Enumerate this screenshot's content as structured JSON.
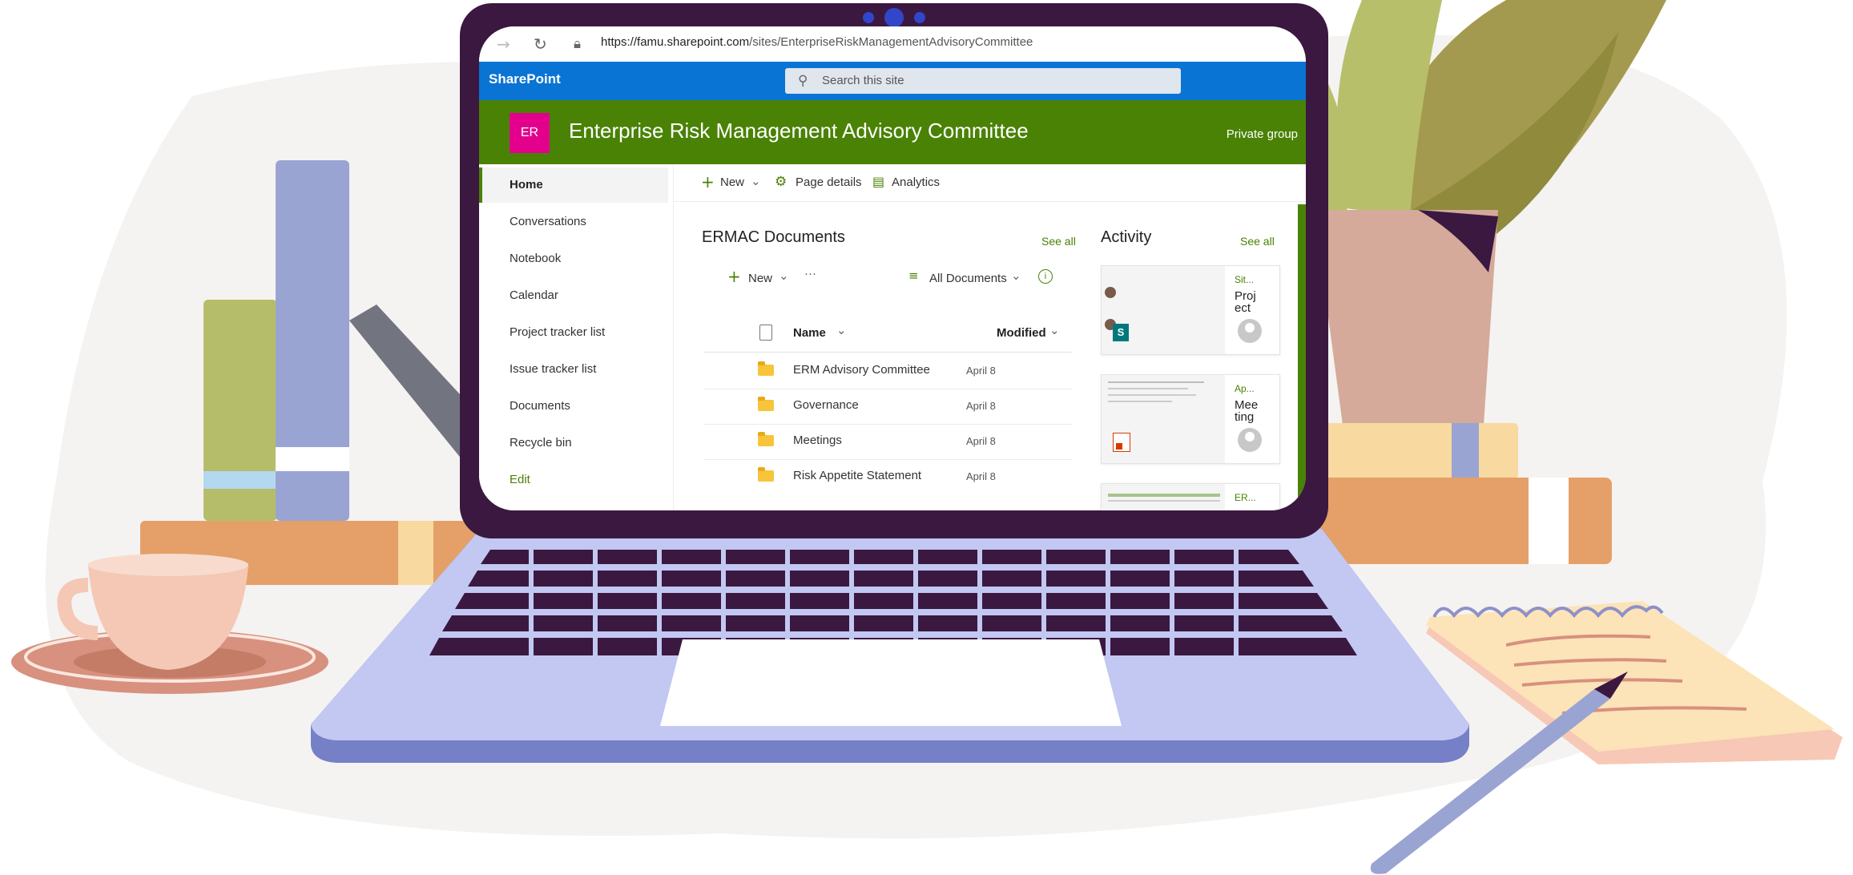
{
  "browser": {
    "url_host": "https://famu.sharepoint.com",
    "url_path": "/sites/EnterpriseRiskManagementAdvisoryCommittee"
  },
  "suite": {
    "brand": "SharePoint",
    "search_placeholder": "Search this site"
  },
  "site": {
    "logo_initials": "ER",
    "title": "Enterprise Risk Management Advisory Committee",
    "privacy": "Private group"
  },
  "nav": {
    "items": [
      {
        "label": "Home"
      },
      {
        "label": "Conversations"
      },
      {
        "label": "Notebook"
      },
      {
        "label": "Calendar"
      },
      {
        "label": "Project tracker list"
      },
      {
        "label": "Issue tracker list"
      },
      {
        "label": "Documents"
      },
      {
        "label": "Recycle bin"
      }
    ],
    "edit_label": "Edit"
  },
  "commandbar": {
    "new_label": "New",
    "page_details_label": "Page details",
    "analytics_label": "Analytics"
  },
  "documents": {
    "title": "ERMAC Documents",
    "see_all": "See all",
    "new_label": "New",
    "more_label": "···",
    "view_label": "All Documents",
    "col_name": "Name",
    "col_modified": "Modified",
    "rows": [
      {
        "name": "ERM Advisory Committee",
        "modified": "April 8"
      },
      {
        "name": "Governance",
        "modified": "April 8"
      },
      {
        "name": "Meetings",
        "modified": "April 8"
      },
      {
        "name": "Risk Appetite Statement",
        "modified": "April 8"
      }
    ]
  },
  "activity": {
    "title": "Activity",
    "see_all": "See all",
    "cards": [
      {
        "tag": "Sit...",
        "title": "Proj ect"
      },
      {
        "tag": "Ap...",
        "title": "Mee ting"
      },
      {
        "tag": "ER...",
        "title": ""
      }
    ]
  },
  "colors": {
    "suite_blue": "#0a74d4",
    "site_green": "#498205",
    "logo_magenta": "#e3008c",
    "laptop_frame": "#3b1840"
  }
}
